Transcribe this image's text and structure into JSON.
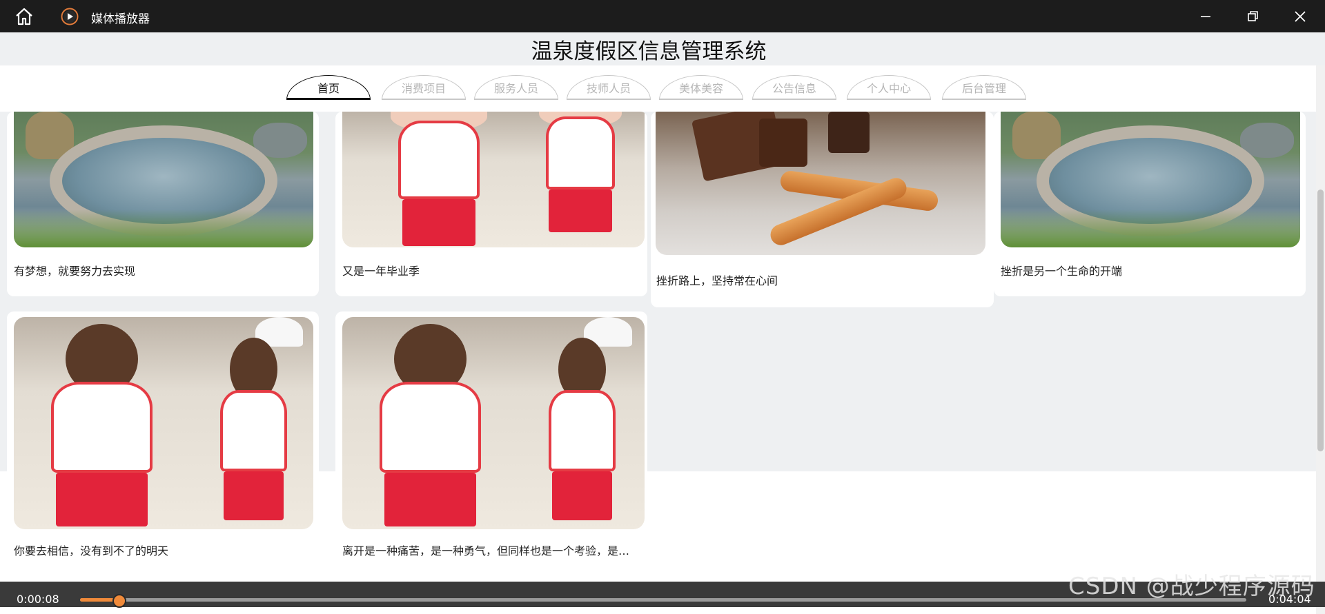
{
  "player": {
    "app_title": "媒体播放器",
    "current_time": "0:00:08",
    "total_time": "0:04:04",
    "progress": 0.033,
    "accent_color": "#f08a3a"
  },
  "site": {
    "title": "温泉度假区信息管理系统"
  },
  "nav": {
    "tabs": [
      "首页",
      "消费项目",
      "服务人员",
      "技师人员",
      "美体美容",
      "公告信息",
      "个人中心",
      "后台管理"
    ],
    "active": "首页"
  },
  "cards": [
    {
      "caption": "有梦想，就要努力去实现",
      "image": "hot-spring-pool"
    },
    {
      "caption": "又是一年毕业季",
      "image": "beach-girls"
    },
    {
      "caption": "挫折路上，坚持常在心间",
      "image": "bread-sticks"
    },
    {
      "caption": "挫折是另一个生命的开端",
      "image": "hot-spring-pool"
    },
    {
      "caption": "你要去相信，没有到不了的明天",
      "image": "beach-girls"
    },
    {
      "caption": "离开是一种痛苦，是一种勇气，但同样也是一个考验，是…",
      "image": "beach-girls"
    }
  ],
  "watermark": "CSDN @战少程序源码",
  "icons": [
    "home-icon",
    "media-player-logo-icon",
    "minimize-icon",
    "restore-icon",
    "close-icon"
  ]
}
